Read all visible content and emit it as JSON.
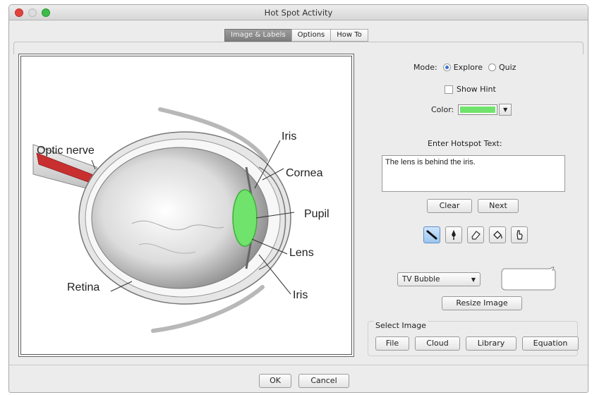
{
  "window": {
    "title": "Hot Spot Activity"
  },
  "tabs": [
    {
      "label": "Image & Labels",
      "active": true
    },
    {
      "label": "Options",
      "active": false
    },
    {
      "label": "How To",
      "active": false
    }
  ],
  "image": {
    "labels": {
      "optic_nerve": "Optic nerve",
      "iris_top": "Iris",
      "cornea": "Cornea",
      "pupil": "Pupil",
      "lens": "Lens",
      "retina": "Retina",
      "iris_bottom": "Iris"
    },
    "hotspot_color": "#6fe36b"
  },
  "controls": {
    "mode_label": "Mode:",
    "mode_options": [
      {
        "label": "Explore",
        "selected": true
      },
      {
        "label": "Quiz",
        "selected": false
      }
    ],
    "show_hint_label": "Show Hint",
    "show_hint_checked": false,
    "color_label": "Color:",
    "color_value": "#6fe36b",
    "hotspot_text_label": "Enter Hotspot Text:",
    "hotspot_text_value": "The lens is behind the iris.",
    "clear_label": "Clear",
    "next_label": "Next",
    "tools": [
      {
        "icon": "pen-line-icon",
        "active": true
      },
      {
        "icon": "pen-nib-icon",
        "active": false
      },
      {
        "icon": "eraser-icon",
        "active": false
      },
      {
        "icon": "paint-bucket-icon",
        "active": false
      },
      {
        "icon": "hand-pointer-icon",
        "active": false
      }
    ],
    "bubble_style": "TV Bubble",
    "resize_label": "Resize Image",
    "select_image_label": "Select Image",
    "select_image_buttons": [
      "File",
      "Cloud",
      "Library",
      "Equation"
    ]
  },
  "footer": {
    "ok_label": "OK",
    "cancel_label": "Cancel"
  }
}
